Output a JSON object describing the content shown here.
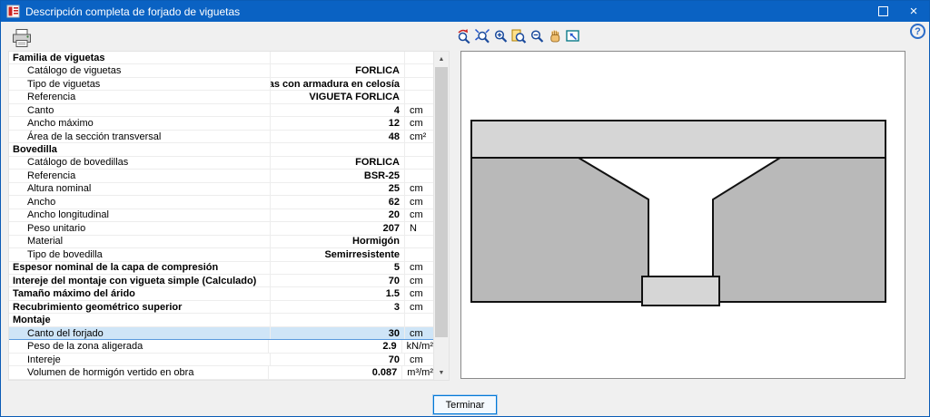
{
  "window": {
    "title": "Descripción completa de forjado de viguetas",
    "close_glyph": "×",
    "help_glyph": "?"
  },
  "scrollbar": {
    "up_glyph": "▲",
    "down_glyph": "▼"
  },
  "table": {
    "rows": [
      {
        "label": "Familia de viguetas",
        "value": "",
        "unit": ""
      },
      {
        "label": "Catálogo de viguetas",
        "value": "FORLICA",
        "unit": ""
      },
      {
        "label": "Tipo de viguetas",
        "value": "Viguetas con armadura en celosía",
        "unit": ""
      },
      {
        "label": "Referencia",
        "value": "VIGUETA FORLICA",
        "unit": ""
      },
      {
        "label": "Canto",
        "value": "4",
        "unit": "cm"
      },
      {
        "label": "Ancho máximo",
        "value": "12",
        "unit": "cm"
      },
      {
        "label": "Área de la sección transversal",
        "value": "48",
        "unit": "cm²"
      },
      {
        "label": "Bovedilla",
        "value": "",
        "unit": ""
      },
      {
        "label": "Catálogo de bovedillas",
        "value": "FORLICA",
        "unit": ""
      },
      {
        "label": "Referencia",
        "value": "BSR-25",
        "unit": ""
      },
      {
        "label": "Altura nominal",
        "value": "25",
        "unit": "cm"
      },
      {
        "label": "Ancho",
        "value": "62",
        "unit": "cm"
      },
      {
        "label": "Ancho longitudinal",
        "value": "20",
        "unit": "cm"
      },
      {
        "label": "Peso unitario",
        "value": "207",
        "unit": "N"
      },
      {
        "label": "Material",
        "value": "Hormigón",
        "unit": ""
      },
      {
        "label": "Tipo de bovedilla",
        "value": "Semirresistente",
        "unit": ""
      },
      {
        "label": "Espesor nominal de la capa de compresión",
        "value": "5",
        "unit": "cm"
      },
      {
        "label": "Intereje del montaje con vigueta simple (Calculado)",
        "value": "70",
        "unit": "cm"
      },
      {
        "label": "Tamaño máximo del árido",
        "value": "1.5",
        "unit": "cm"
      },
      {
        "label": "Recubrimiento geométrico superior",
        "value": "3",
        "unit": "cm"
      },
      {
        "label": "Montaje",
        "value": "",
        "unit": ""
      },
      {
        "label": "Canto del forjado",
        "value": "30",
        "unit": "cm"
      },
      {
        "label": "Peso de la zona aligerada",
        "value": "2.9",
        "unit": "kN/m²"
      },
      {
        "label": "Intereje",
        "value": "70",
        "unit": "cm"
      },
      {
        "label": "Volumen de hormigón vertido en obra",
        "value": "0.087",
        "unit": "m³/m²"
      }
    ]
  },
  "viewer": {
    "tools": [
      "zoom-back-icon",
      "zoom-extents-icon",
      "zoom-in-icon",
      "zoom-sheet-icon",
      "zoom-out-icon",
      "pan-icon",
      "fit-view-icon"
    ]
  },
  "footer": {
    "terminar_label": "Terminar"
  },
  "colors": {
    "titlebar": "#0a62c3",
    "accent": "#0078d7",
    "selected_row": "#cfe5f7",
    "slab_fill": "#d6d6d6",
    "block_fill": "#b9b9b9"
  }
}
